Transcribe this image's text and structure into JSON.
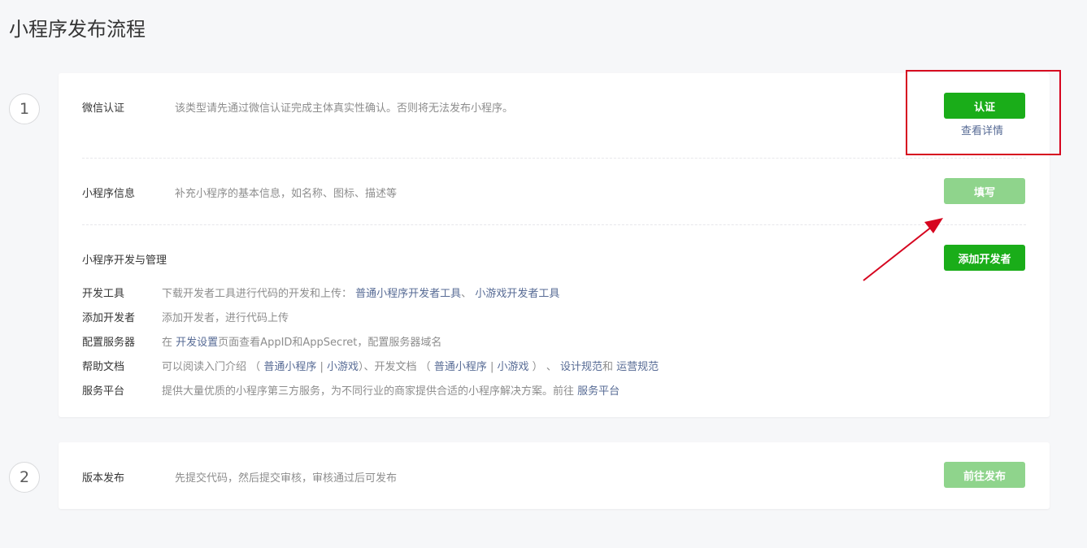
{
  "page": {
    "title": "小程序发布流程"
  },
  "steps": {
    "one": "1",
    "two": "2"
  },
  "verify": {
    "label": "微信认证",
    "desc": "该类型请先通过微信认证完成主体真实性确认。否则将无法发布小程序。",
    "button": "认证",
    "details_link": "查看详情"
  },
  "info": {
    "label": "小程序信息",
    "desc": "补充小程序的基本信息，如名称、图标、描述等",
    "button": "填写"
  },
  "dev": {
    "label": "小程序开发与管理",
    "button": "添加开发者",
    "rows": {
      "tools": {
        "label": "开发工具",
        "desc": "下载开发者工具进行代码的开发和上传：",
        "link1": "普通小程序开发者工具",
        "sep": "、",
        "link2": "小游戏开发者工具"
      },
      "add": {
        "label": "添加开发者",
        "desc": "添加开发者，进行代码上传"
      },
      "server": {
        "label": "配置服务器",
        "pre": "在",
        "link": "开发设置",
        "post": "页面查看AppID和AppSecret，配置服务器域名"
      },
      "help": {
        "label": "帮助文档",
        "pre": "可以阅读入门介绍",
        "open1": "（",
        "link1": "普通小程序",
        "bar1": "|",
        "link2": "小游戏",
        "mid": "）、开发文档",
        "open2": "（",
        "link3": "普通小程序",
        "bar2": "|",
        "link4": "小游戏",
        "close2": "）",
        "sep": "、",
        "link5": "设计规范",
        "and": "和",
        "link6": "运营规范"
      },
      "platform": {
        "label": "服务平台",
        "desc": "提供大量优质的小程序第三方服务，为不同行业的商家提供合适的小程序解决方案。前往",
        "link": "服务平台"
      }
    }
  },
  "release": {
    "label": "版本发布",
    "desc": "先提交代码，然后提交审核，审核通过后可发布",
    "button": "前往发布"
  },
  "colors": {
    "primary_green": "#1aad19",
    "disabled_green": "#8fd48c",
    "link_blue": "#576b95",
    "annotation_red": "#d6051f"
  }
}
